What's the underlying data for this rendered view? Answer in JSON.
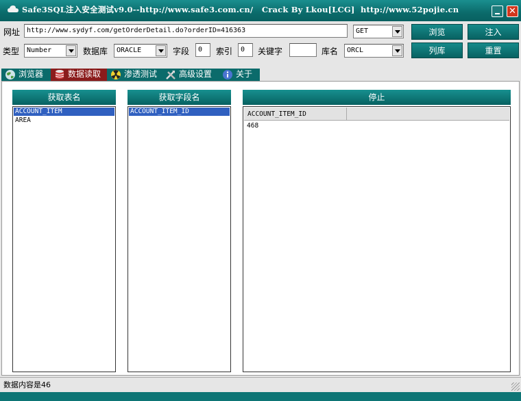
{
  "window": {
    "title": "Safe3SQL注入安全测试v9.0--http://www.safe3.com.cn/   Crack By Lkou[LCG]  http://www.52pojie.cn"
  },
  "form": {
    "url_label": "网址",
    "url_value": "http://www.sydyf.com/getOrderDetail.do?orderID=416363",
    "method_value": "GET",
    "type_label": "类型",
    "type_value": "Number",
    "db_label": "数据库",
    "db_value": "ORACLE",
    "field_label": "字段",
    "field_value": "0",
    "index_label": "索引",
    "index_value": "0",
    "keyword_label": "关键字",
    "keyword_value": "",
    "dbname_label": "库名",
    "dbname_value": "ORCL"
  },
  "buttons": {
    "browse": "浏览",
    "inject": "注入",
    "list_db": "列库",
    "reset": "重置"
  },
  "tabs": [
    {
      "label": "浏览器"
    },
    {
      "label": "数据读取"
    },
    {
      "label": "渗透测试"
    },
    {
      "label": "高级设置"
    },
    {
      "label": "关于"
    }
  ],
  "panels": {
    "tables_header": "获取表名",
    "tables": [
      "ACCOUNT_ITEM",
      "AREA"
    ],
    "fields_header": "获取字段名",
    "fields": [
      "ACCOUNT_ITEM_ID"
    ],
    "stop_header": "停止",
    "grid_column": "ACCOUNT_ITEM_ID",
    "grid_value": "468"
  },
  "status": {
    "text": "数据内容是46"
  },
  "colors": {
    "accent": "#0d7575",
    "active_tab": "#8a1c1c",
    "selection": "#3060c0"
  }
}
